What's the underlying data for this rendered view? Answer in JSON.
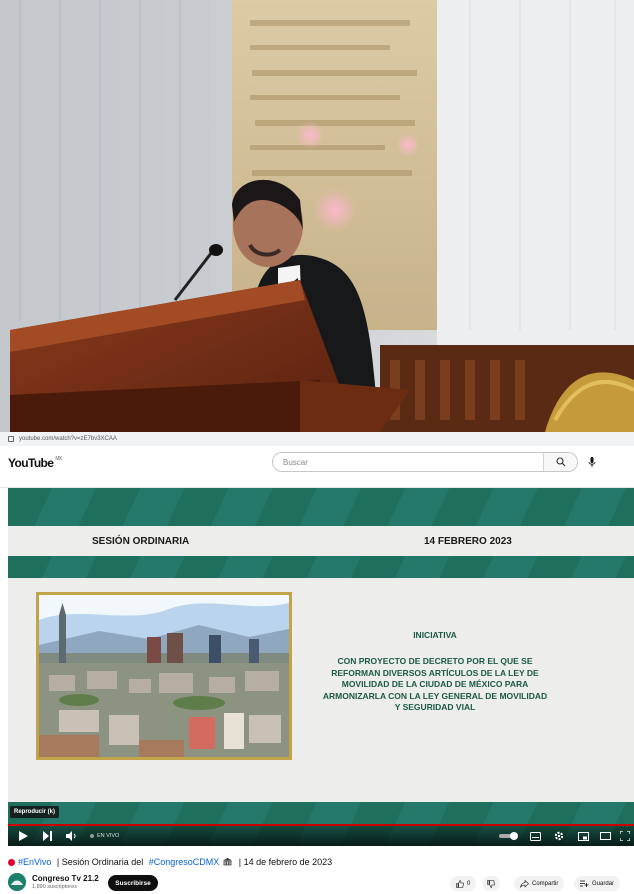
{
  "browser": {
    "url": "youtube.com/watch?v=zE7bv3XCAA"
  },
  "header": {
    "logo": "YouTube",
    "logo_region": "MX",
    "search_placeholder": "Buscar"
  },
  "video": {
    "session_label": "SESIÓN ORDINARIA",
    "date_label": "14 FEBRERO 2023",
    "iniciativa_heading": "INICIATIVA",
    "iniciativa_lines": [
      "CON PROYECTO DE DECRETO POR EL QUE SE",
      "REFORMAN DIVERSOS ARTÍCULOS DE LA LEY DE",
      "MOVILIDAD DE LA CIUDAD DE MÉXICO PARA",
      "ARMONIZARLA CON LA LEY GENERAL DE MOVILIDAD",
      "Y SEGURIDAD VIAL"
    ],
    "tooltip": "Reproducir (k)",
    "live_label": "EN VIVO"
  },
  "below": {
    "title_hashtag": "#EnVivo",
    "title_mid": " | Sesión Ordinaria del ",
    "title_hashtag2": "#CongresoCDMX",
    "title_end": " | 14 de febrero de 2023",
    "channel_name": "Congreso Tv 21.2",
    "subscribers": "1,890 suscriptores",
    "subscribe_label": "Suscribirse",
    "like_count": "0",
    "share_label": "Compartir",
    "save_label": "Guardar"
  },
  "colors": {
    "green_band": "#1f6f5d",
    "panel_bg": "#ededeb",
    "gold_frame": "#c2a34a",
    "text_green": "#1c5a46",
    "progress_red": "#cc0000",
    "live_red": "#e1002d"
  },
  "icons": [
    "lock-icon",
    "search-icon",
    "mic-icon",
    "play-icon",
    "next-icon",
    "volume-icon",
    "toggle-icon",
    "subtitles-icon",
    "settings-icon",
    "miniplayer-icon",
    "theater-icon",
    "fullscreen-icon",
    "like-icon",
    "dislike-icon",
    "share-icon",
    "save-icon"
  ]
}
